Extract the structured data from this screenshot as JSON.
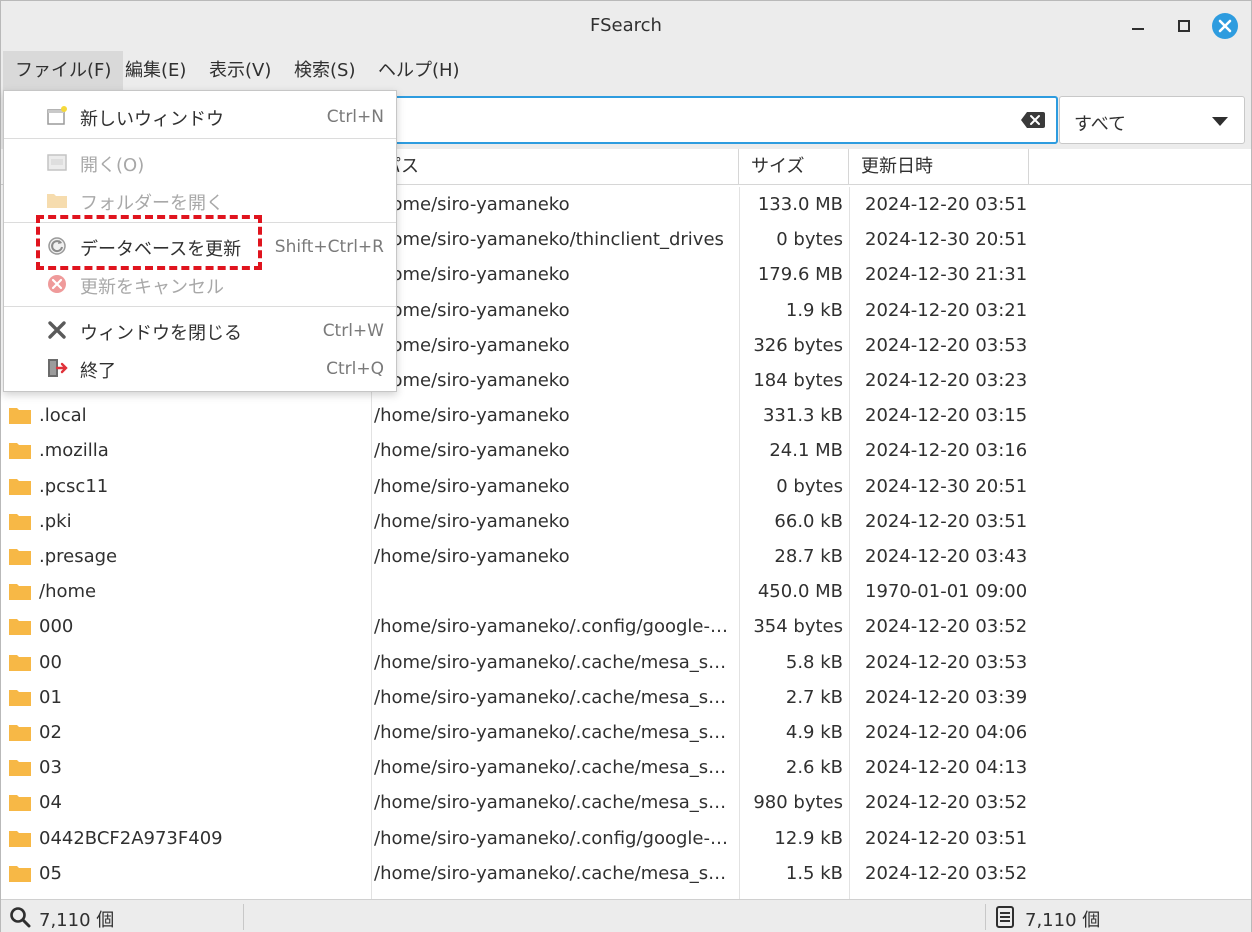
{
  "window": {
    "title": "FSearch"
  },
  "menubar": [
    {
      "label": "ファイル(F)",
      "active": true
    },
    {
      "label": "編集(E)"
    },
    {
      "label": "表示(V)"
    },
    {
      "label": "検索(S)"
    },
    {
      "label": "ヘルプ(H)"
    }
  ],
  "search": {
    "value": "",
    "placeholder": ""
  },
  "filter": {
    "selected": "すべて"
  },
  "columns": {
    "path": "パス",
    "size": "サイズ",
    "modified": "更新日時"
  },
  "file_menu": {
    "items": [
      {
        "label": "新しいウィンドウ",
        "shortcut": "Ctrl+N",
        "icon": "new-window-icon",
        "disabled": false
      },
      {
        "label": "開く(O)",
        "shortcut": "",
        "icon": "open-icon",
        "disabled": true
      },
      {
        "label": "フォルダーを開く",
        "shortcut": "",
        "icon": "open-folder-icon",
        "disabled": true
      },
      {
        "label": "データベースを更新",
        "shortcut": "Shift+Ctrl+R",
        "icon": "refresh-icon",
        "disabled": false
      },
      {
        "label": "更新をキャンセル",
        "shortcut": "",
        "icon": "cancel-icon",
        "disabled": true
      },
      {
        "label": "ウィンドウを閉じる",
        "shortcut": "Ctrl+W",
        "icon": "close-window-icon",
        "disabled": false
      },
      {
        "label": "終了",
        "shortcut": "Ctrl+Q",
        "icon": "quit-icon",
        "disabled": false
      }
    ]
  },
  "rows": [
    {
      "name": "",
      "path": "/home/siro-yamaneko",
      "size": "133.0 MB",
      "modified": "2024-12-20 03:51"
    },
    {
      "name": "",
      "path": "/home/siro-yamaneko/thinclient_drives",
      "size": "0 bytes",
      "modified": "2024-12-30 20:51"
    },
    {
      "name": "",
      "path": "/home/siro-yamaneko",
      "size": "179.6 MB",
      "modified": "2024-12-30 21:31"
    },
    {
      "name": "",
      "path": "/home/siro-yamaneko",
      "size": "1.9 kB",
      "modified": "2024-12-20 03:21"
    },
    {
      "name": "",
      "path": "/home/siro-yamaneko",
      "size": "326 bytes",
      "modified": "2024-12-20 03:53"
    },
    {
      "name": "",
      "path": "/home/siro-yamaneko",
      "size": "184 bytes",
      "modified": "2024-12-20 03:23"
    },
    {
      "name": ".local",
      "path": "/home/siro-yamaneko",
      "size": "331.3 kB",
      "modified": "2024-12-20 03:15"
    },
    {
      "name": ".mozilla",
      "path": "/home/siro-yamaneko",
      "size": "24.1 MB",
      "modified": "2024-12-20 03:16"
    },
    {
      "name": ".pcsc11",
      "path": "/home/siro-yamaneko",
      "size": "0 bytes",
      "modified": "2024-12-30 20:51"
    },
    {
      "name": ".pki",
      "path": "/home/siro-yamaneko",
      "size": "66.0 kB",
      "modified": "2024-12-20 03:51"
    },
    {
      "name": ".presage",
      "path": "/home/siro-yamaneko",
      "size": "28.7 kB",
      "modified": "2024-12-20 03:43"
    },
    {
      "name": "/home",
      "path": "",
      "size": "450.0 MB",
      "modified": "1970-01-01 09:00"
    },
    {
      "name": "000",
      "path": "/home/siro-yamaneko/.config/google-…",
      "size": "354 bytes",
      "modified": "2024-12-20 03:52"
    },
    {
      "name": "00",
      "path": "/home/siro-yamaneko/.cache/mesa_s…",
      "size": "5.8 kB",
      "modified": "2024-12-20 03:53"
    },
    {
      "name": "01",
      "path": "/home/siro-yamaneko/.cache/mesa_s…",
      "size": "2.7 kB",
      "modified": "2024-12-20 03:39"
    },
    {
      "name": "02",
      "path": "/home/siro-yamaneko/.cache/mesa_s…",
      "size": "4.9 kB",
      "modified": "2024-12-20 04:06"
    },
    {
      "name": "03",
      "path": "/home/siro-yamaneko/.cache/mesa_s…",
      "size": "2.6 kB",
      "modified": "2024-12-20 04:13"
    },
    {
      "name": "04",
      "path": "/home/siro-yamaneko/.cache/mesa_s…",
      "size": "980 bytes",
      "modified": "2024-12-20 03:52"
    },
    {
      "name": "0442BCF2A973F409",
      "path": "/home/siro-yamaneko/.config/google-…",
      "size": "12.9 kB",
      "modified": "2024-12-20 03:51"
    },
    {
      "name": "05",
      "path": "/home/siro-yamaneko/.cache/mesa_s…",
      "size": "1.5 kB",
      "modified": "2024-12-20 03:52"
    }
  ],
  "status": {
    "result_count": "7,110 個",
    "db_count": "7,110 個"
  },
  "colors": {
    "accent": "#2e9cdf",
    "highlight": "#e0141e",
    "folder": "#f7b846"
  }
}
